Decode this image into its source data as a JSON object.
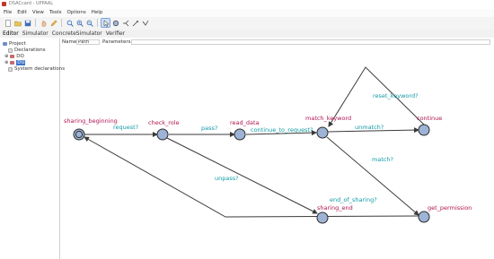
{
  "window": {
    "title": "DSACcard - UPPAAL"
  },
  "menu": [
    "File",
    "Edit",
    "View",
    "Tools",
    "Options",
    "Help"
  ],
  "tabs": [
    "Editor",
    "Simulator",
    "ConcreteSimulator",
    "Verifier"
  ],
  "tree": {
    "project": "Project",
    "declarations": "Declarations",
    "template_1": "DO",
    "template_2": "DU",
    "system": "System declarations"
  },
  "fields": {
    "name_label": "Name:",
    "name_value": "Path",
    "params_label": "Parameters:"
  },
  "locations": {
    "sharing_beginning": "sharing_beginning",
    "check_role": "check_role",
    "read_data": "read_data",
    "match_keyword": "match_keyword",
    "continue": "continue",
    "get_permission": "get_permission",
    "sharing_end": "sharing_end"
  },
  "edges": {
    "request": "request?",
    "pass": "pass?",
    "continue_to_request": "continue_to_request?",
    "unmatch": "unmatch?",
    "reset_keyword": "reset_keyword?",
    "match": "match?",
    "unpass": "unpass?",
    "end_of_sharing": "end_of_sharing?"
  },
  "colors": {
    "location_label": "#b0134f",
    "edge_label": "#0e9aa7",
    "node_fill": "#9eb4d6",
    "edge": "#3a3a3a"
  }
}
